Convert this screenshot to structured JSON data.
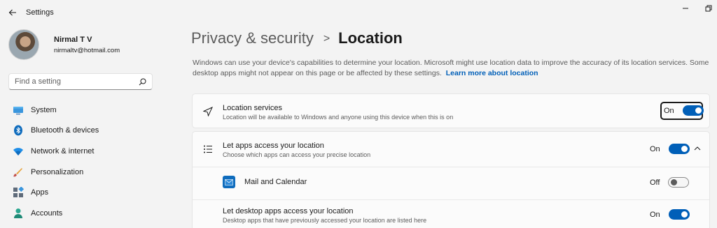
{
  "window": {
    "app_title": "Settings"
  },
  "profile": {
    "name": "Nirmal T V",
    "email": "nirmaltv@hotmail.com"
  },
  "search": {
    "placeholder": "Find a setting",
    "icon": "search-icon"
  },
  "sidebar": {
    "items": [
      {
        "label": "System",
        "icon": "system-icon"
      },
      {
        "label": "Bluetooth & devices",
        "icon": "bluetooth-icon"
      },
      {
        "label": "Network & internet",
        "icon": "network-icon"
      },
      {
        "label": "Personalization",
        "icon": "personalization-icon"
      },
      {
        "label": "Apps",
        "icon": "apps-icon"
      },
      {
        "label": "Accounts",
        "icon": "accounts-icon"
      }
    ]
  },
  "breadcrumb": {
    "parent": "Privacy & security",
    "separator": ">",
    "current": "Location"
  },
  "description": {
    "text": "Windows can use your device's capabilities to determine your location. Microsoft might use location data to improve the accuracy of its location services. Some desktop apps might not appear on this page or be affected by these settings.",
    "link": "Learn more about location"
  },
  "settings": {
    "location_services": {
      "title": "Location services",
      "subtitle": "Location will be available to Windows and anyone using this device when this is on",
      "state": "On",
      "on": true
    },
    "apps_access": {
      "title": "Let apps access your location",
      "subtitle": "Choose which apps can access your precise location",
      "state": "On",
      "on": true
    },
    "mail_calendar": {
      "title": "Mail and Calendar",
      "state": "Off",
      "on": false
    },
    "desktop_apps": {
      "title": "Let desktop apps access your location",
      "subtitle": "Desktop apps that have previously accessed your location are listed here",
      "state": "On",
      "on": true
    }
  },
  "colors": {
    "accent": "#005fb8",
    "background": "#f3f3f3",
    "card": "#fbfbfb"
  }
}
